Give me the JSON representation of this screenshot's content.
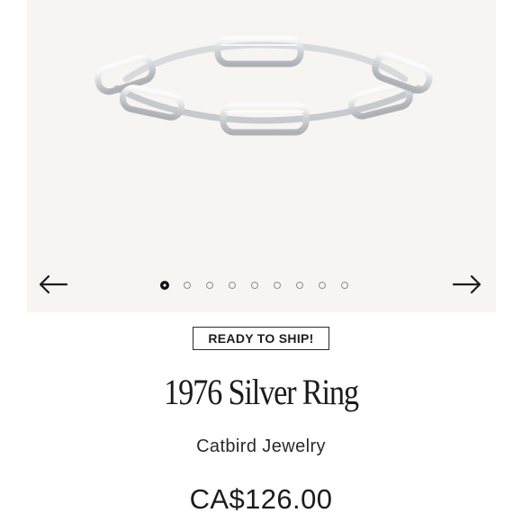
{
  "gallery": {
    "image_alt": "1976 Silver Ring",
    "prev_icon": "arrow-left-icon",
    "next_icon": "arrow-right-icon",
    "dot_count": 9,
    "active_index": 0
  },
  "product": {
    "badge": "READY TO SHIP!",
    "title": "1976 Silver Ring",
    "brand": "Catbird Jewelry",
    "price": "CA$126.00"
  },
  "colors": {
    "gallery_background": "#f6f5f2",
    "text": "#1a1a1a",
    "silver": "#c9ccd0"
  }
}
